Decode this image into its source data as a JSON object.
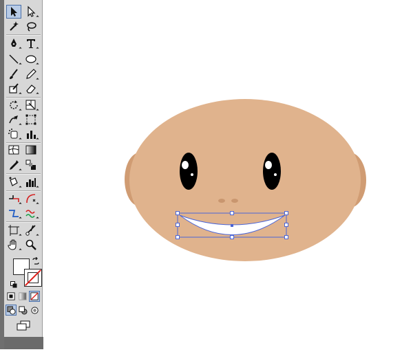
{
  "toolbox": {
    "tools": [
      {
        "name": "selection-tool-icon",
        "active": true
      },
      {
        "name": "direct-selection-tool-icon"
      },
      {
        "name": "magic-wand-tool-icon"
      },
      {
        "name": "lasso-tool-icon"
      },
      {
        "name": "pen-tool-icon"
      },
      {
        "name": "type-tool-icon"
      },
      {
        "name": "line-segment-tool-icon"
      },
      {
        "name": "ellipse-tool-icon"
      },
      {
        "name": "paintbrush-tool-icon"
      },
      {
        "name": "pencil-tool-icon"
      },
      {
        "name": "blob-brush-tool-icon"
      },
      {
        "name": "eraser-tool-icon"
      },
      {
        "name": "rotate-tool-icon"
      },
      {
        "name": "scale-tool-icon"
      },
      {
        "name": "warp-tool-icon"
      },
      {
        "name": "free-transform-tool-icon"
      },
      {
        "name": "symbol-sprayer-tool-icon"
      },
      {
        "name": "column-graph-tool-icon"
      },
      {
        "name": "mesh-tool-icon"
      },
      {
        "name": "gradient-tool-icon"
      },
      {
        "name": "eyedropper-tool-icon"
      },
      {
        "name": "blend-tool-icon"
      },
      {
        "name": "live-paint-bucket-tool-icon"
      },
      {
        "name": "bar-graph-tool-icon"
      },
      {
        "name": "slice-tool-icon"
      },
      {
        "name": "scissors-tool-icon"
      },
      {
        "name": "hand-tool-icon"
      },
      {
        "name": "zoom-tool-icon"
      }
    ],
    "fill_color": "#ffffff",
    "stroke_color": "none"
  },
  "artwork": {
    "face_color": "#e0b38d",
    "ear_color": "#d09c73",
    "selection_color": "#4a64d6"
  }
}
